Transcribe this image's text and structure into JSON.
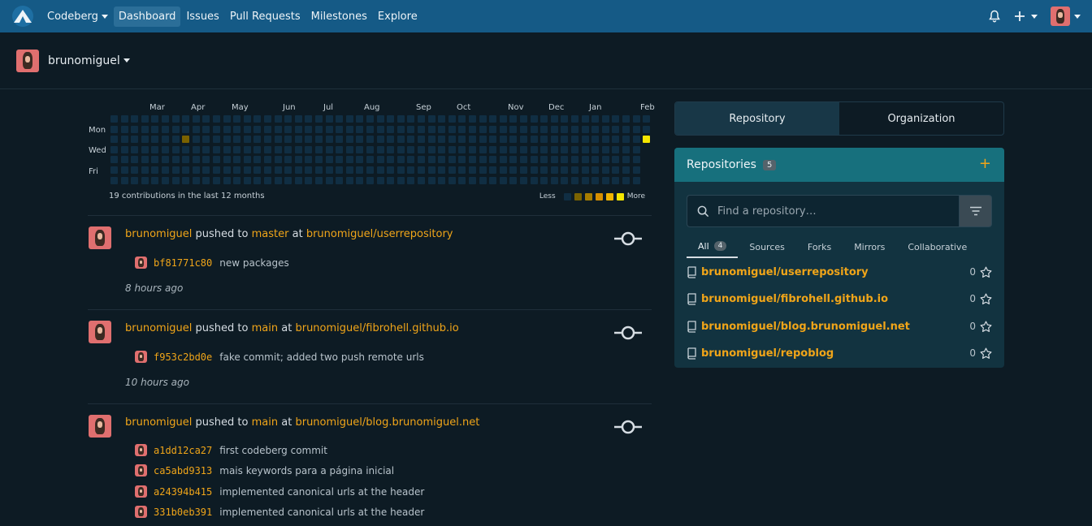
{
  "navbar": {
    "brand": "Codeberg",
    "items": [
      "Dashboard",
      "Issues",
      "Pull Requests",
      "Milestones",
      "Explore"
    ],
    "active": "Dashboard"
  },
  "context": {
    "username": "brunomiguel"
  },
  "heatmap": {
    "months": [
      "Mar",
      "Apr",
      "May",
      "Jun",
      "Jul",
      "Aug",
      "Sep",
      "Oct",
      "Nov",
      "Dec",
      "Jan",
      "Feb"
    ],
    "days": [
      "Mon",
      "Wed",
      "Fri"
    ],
    "summary": "19 contributions in the last 12 months",
    "legend_less": "Less",
    "legend_more": "More",
    "colors": {
      "empty": "#102e43",
      "levels": [
        "#7a6200",
        "#a77d00",
        "#d68f00",
        "#f0b400",
        "#f5e600"
      ]
    }
  },
  "feed": [
    {
      "user": "brunomiguel",
      "action": "pushed to",
      "branch": "master",
      "at": "at",
      "repo": "brunomiguel/userrepository",
      "commits": [
        {
          "sha": "bf81771c80",
          "message": "new packages"
        }
      ],
      "time": "8 hours ago"
    },
    {
      "user": "brunomiguel",
      "action": "pushed to",
      "branch": "main",
      "at": "at",
      "repo": "brunomiguel/fibrohell.github.io",
      "commits": [
        {
          "sha": "f953c2bd0e",
          "message": "fake commit; added two push remote urls"
        }
      ],
      "time": "10 hours ago"
    },
    {
      "user": "brunomiguel",
      "action": "pushed to",
      "branch": "main",
      "at": "at",
      "repo": "brunomiguel/blog.brunomiguel.net",
      "commits": [
        {
          "sha": "a1dd12ca27",
          "message": "first codeberg commit"
        },
        {
          "sha": "ca5abd9313",
          "message": "mais keywords para a página inicial"
        },
        {
          "sha": "a24394b415",
          "message": "implemented canonical urls at the header"
        },
        {
          "sha": "331b0eb391",
          "message": "implemented canonical urls at the header"
        }
      ]
    }
  ],
  "sidebar": {
    "tabs": [
      "Repository",
      "Organization"
    ],
    "repos_title": "Repositories",
    "repos_count": "5",
    "search_placeholder": "Find a repository…",
    "filters": [
      {
        "label": "All",
        "count": "4"
      },
      {
        "label": "Sources"
      },
      {
        "label": "Forks"
      },
      {
        "label": "Mirrors"
      },
      {
        "label": "Collaborative"
      }
    ],
    "repos": [
      {
        "name": "brunomiguel/userrepository",
        "stars": "0"
      },
      {
        "name": "brunomiguel/fibrohell.github.io",
        "stars": "0"
      },
      {
        "name": "brunomiguel/blog.brunomiguel.net",
        "stars": "0"
      },
      {
        "name": "brunomiguel/repoblog",
        "stars": "0"
      }
    ]
  }
}
